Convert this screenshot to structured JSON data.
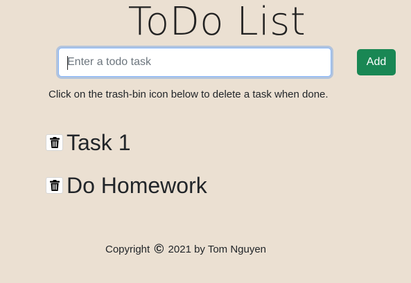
{
  "header": {
    "title": "ToDo List"
  },
  "form": {
    "input_value": "",
    "input_placeholder": "Enter a todo task",
    "add_label": "Add"
  },
  "hint": "Click on the trash-bin icon below to delete a task when done.",
  "todos": [
    {
      "text": "Task 1",
      "icon": "trash-icon"
    },
    {
      "text": "Do Homework",
      "icon": "trash-icon"
    }
  ],
  "footer": {
    "prefix": "Copyright",
    "symbol": "©",
    "suffix": "2021 by Tom Nguyen"
  },
  "colors": {
    "background": "#ebe0d2",
    "add_button": "#198754",
    "input_focus_border": "#86b7fe"
  }
}
